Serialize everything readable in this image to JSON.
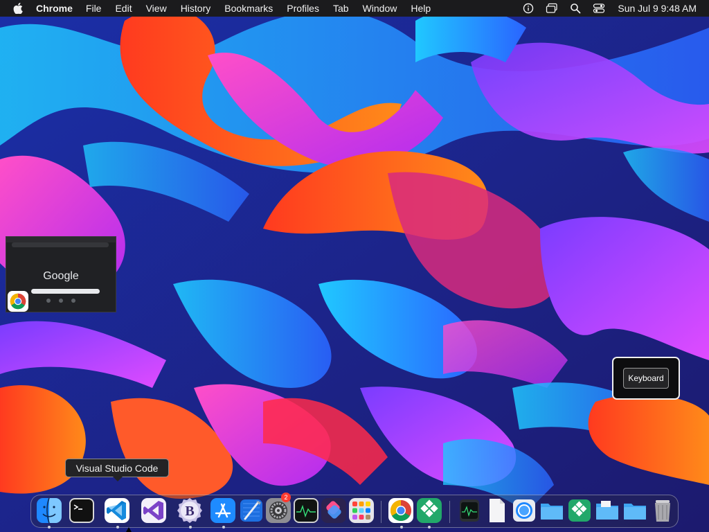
{
  "menubar": {
    "app_name": "Chrome",
    "items": [
      "File",
      "Edit",
      "View",
      "History",
      "Bookmarks",
      "Profiles",
      "Tab",
      "Window",
      "Help"
    ],
    "clock": "Sun Jul 9  9:48 AM"
  },
  "thumbnail": {
    "logo_text": "Google"
  },
  "keyboard_widget": {
    "label": "Keyboard"
  },
  "dock": {
    "tooltip": "Visual Studio Code",
    "calendar_badge": "2"
  },
  "colors": {
    "menubar_bg": "#1b1b1d",
    "accent_blue": "#0a84ff"
  }
}
